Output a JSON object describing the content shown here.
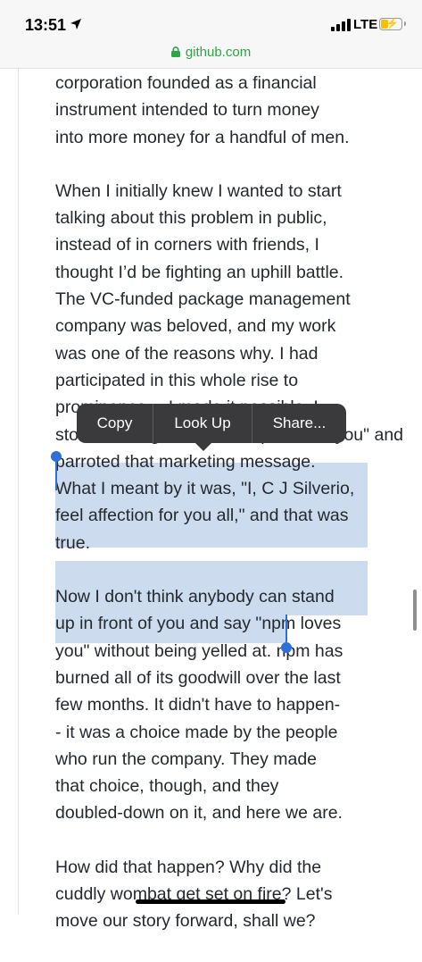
{
  "status_bar": {
    "time": "13:51",
    "network": "LTE",
    "icons": [
      "location-arrow-icon",
      "signal-icon",
      "battery-charging-icon"
    ]
  },
  "browser": {
    "url": "github.com",
    "icons": [
      "lock-icon"
    ],
    "url_color": "#29a745"
  },
  "article": {
    "paragraphs": [
      {
        "lines": [
          "corporation founded as a financial",
          "instrument intended to turn money",
          "into more money for a handful of men."
        ]
      },
      {
        "lines": [
          "When I initially knew I wanted to start",
          "talking about this problem in public,",
          "instead of in corners with friends, I",
          "thought I’d be fighting an uphill battle.",
          "The VC-funded package management",
          "company was beloved, and my work",
          "was one of the reasons why. I had",
          "participated in this whole rise to",
          "prominence— I made it possible. I",
          "stood on stage and said \"npm loves you\" and",
          "parroted that marketing message.",
          "What I meant by it was, \"I, C J Silverio,",
          "feel affection for you all,\" and that was",
          "true."
        ]
      },
      {
        "lines": [
          "Now I don't think anybody can stand",
          "up in front of you and say \"npm loves",
          "you\" without being yelled at. npm has",
          "burned all of its goodwill over the last",
          "few months. It didn't have to happen-",
          "- it was a choice made by the people",
          "who run the company. They made",
          "that choice, though, and they",
          "doubled-down on it, and here we are."
        ]
      },
      {
        "lines": [
          "How did that happen? Why did the",
          "cuddly wombat get set on fire? Let's",
          "move our story forward, shall we?"
        ]
      }
    ]
  },
  "context_menu": {
    "items": [
      "Copy",
      "Look Up",
      "Share..."
    ]
  },
  "colors": {
    "selection": "#c8d7ea",
    "selection_handle": "#2f6fd8",
    "menu_background": "#3a3a3c"
  }
}
